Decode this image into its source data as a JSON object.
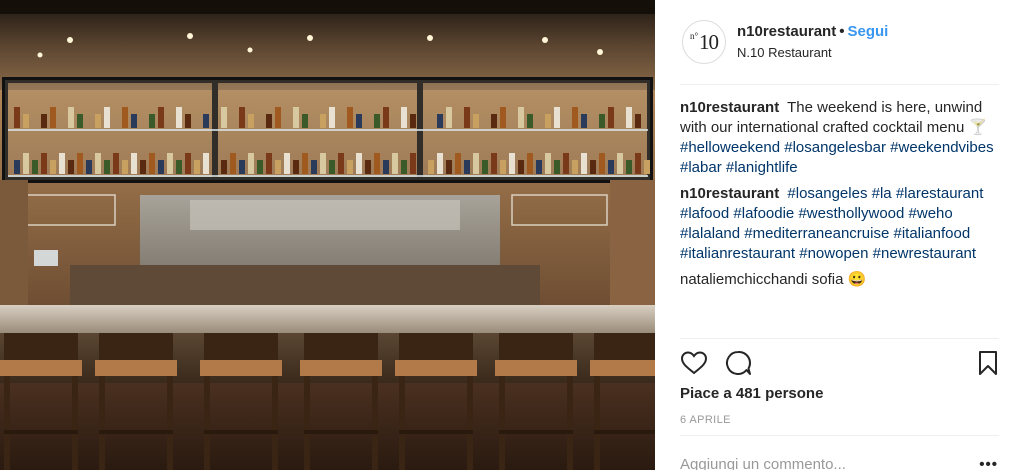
{
  "post": {
    "image_alt": "Bar interior with cocktail shelves and stools",
    "username": "n10restaurant",
    "follow_label": "Segui",
    "location": "N.10 Restaurant",
    "avatar_sup": "n°",
    "avatar_num": "10",
    "comments": [
      {
        "author": "n10restaurant",
        "text": "The weekend is here, unwind with our international crafted cocktail menu 🍸",
        "tags": [
          "#helloweekend",
          "#losangelesbar",
          "#weekendvibes",
          "#labar",
          "#lanightlife"
        ]
      },
      {
        "author": "n10restaurant",
        "text": "",
        "tags": [
          "#losangeles",
          "#la",
          "#larestaurant",
          "#lafood",
          "#lafoodie",
          "#westhollywood",
          "#weho",
          "#lalaland",
          "#mediterraneancruise",
          "#italianfood",
          "#italianrestaurant",
          "#nowopen",
          "#newrestaurant"
        ]
      }
    ],
    "partial_comment": "nataliemchicchandi sofia 😀",
    "likes": "Piace a 481 persone",
    "date": "6 APRILE",
    "add_comment_placeholder": "Aggiungi un commento...",
    "more_label": "•••",
    "icons": {
      "like": "heart-icon",
      "comment": "comment-bubble-icon",
      "save": "bookmark-icon"
    }
  },
  "colors": {
    "link": "#003569",
    "follow": "#3897f0",
    "muted": "#999999"
  }
}
